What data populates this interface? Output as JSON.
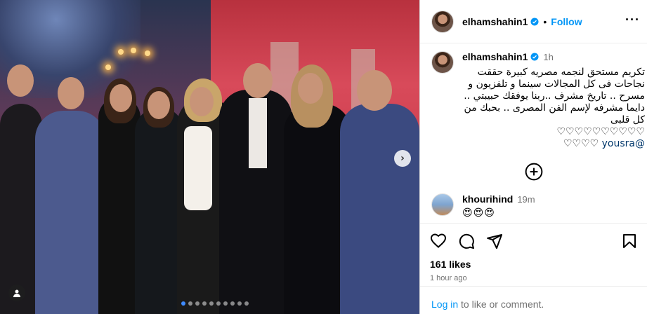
{
  "post": {
    "username": "elhamshahin1",
    "follow_label": "Follow",
    "separator": "•",
    "more_label": "···"
  },
  "caption": {
    "username": "elhamshahin1",
    "time": "1h",
    "text": "تكريم مستحق لنجمه مصريه كبيرة حققت نجاحات  فى كل المجالات سينما و تلفزيون و مسرح .. تاريخ مشرف ..ربنا يوفقك حبيبتي .. دايما مشرفه لإسم الفن المصرى .. بحبك من كل قلبى",
    "hearts_row1": "♡♡♡♡♡♡♡♡♡♡",
    "hearts_row2": "♡♡♡♡",
    "mention": "@yousra"
  },
  "comment": {
    "username": "khourihind",
    "time": "19m",
    "emojis": "😍😍😍"
  },
  "carousel": {
    "total": 10,
    "active_index": 0
  },
  "stats": {
    "likes": "161 likes",
    "posted": "1 hour ago"
  },
  "login_prompt": {
    "link": "Log in",
    "rest": " to like or comment."
  },
  "colors": {
    "accent": "#0095f6",
    "verified": "#0095f6",
    "mention": "#00376b",
    "muted": "#737373"
  },
  "icons": {
    "like": "heart-icon",
    "comment": "comment-icon",
    "share": "share-icon",
    "save": "bookmark-icon",
    "load_more": "plus-circle-icon",
    "next": "chevron-right-icon",
    "tag": "user-tag-icon"
  }
}
